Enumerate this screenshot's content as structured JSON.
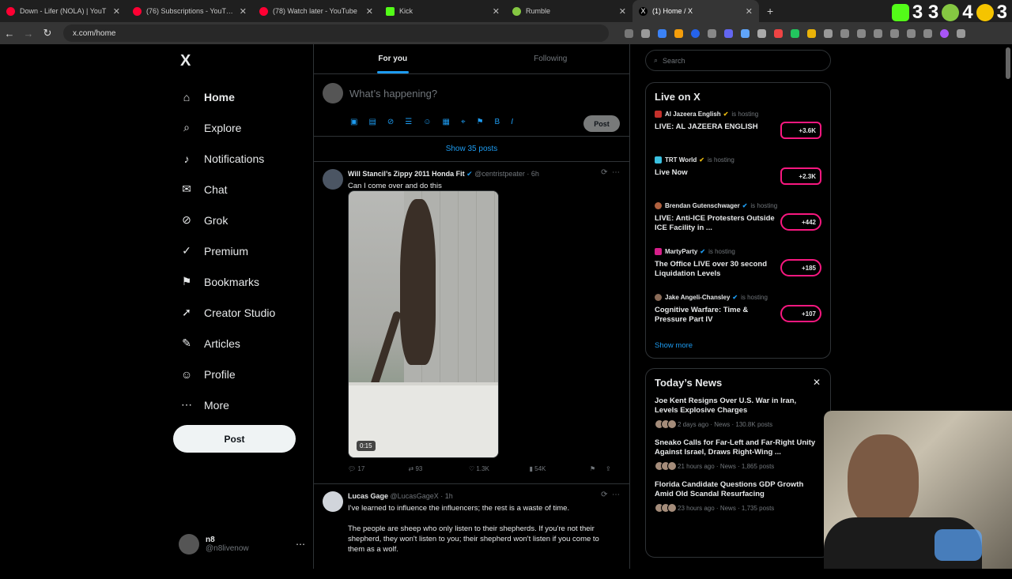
{
  "browser": {
    "tabs": [
      {
        "title": "Down - Lifer (NOLA) | YouT",
        "color": "#ff0033",
        "active": false
      },
      {
        "title": "(76) Subscriptions - YouTube",
        "color": "#ff0033",
        "active": false
      },
      {
        "title": "(78) Watch later - YouTube",
        "color": "#ff0033",
        "active": false
      },
      {
        "title": "Kick",
        "color": "#53fc18",
        "active": false
      },
      {
        "title": "Rumble",
        "color": "#85c742",
        "active": false
      },
      {
        "title": "(1) Home / X",
        "color": "#ffffff",
        "active": true
      }
    ],
    "url": "x.com/home",
    "tray": {
      "kick_count": "3 3",
      "rumble_count": "4",
      "other_count": "3"
    }
  },
  "sidebar": {
    "logo": "X",
    "items": [
      {
        "label": "Home",
        "icon": "home-icon",
        "glyph": "⌂"
      },
      {
        "label": "Explore",
        "icon": "search-icon",
        "glyph": "⌕"
      },
      {
        "label": "Notifications",
        "icon": "bell-icon",
        "glyph": "♪"
      },
      {
        "label": "Chat",
        "icon": "mail-icon",
        "glyph": "✉"
      },
      {
        "label": "Grok",
        "icon": "grok-icon",
        "glyph": "⊘"
      },
      {
        "label": "Premium",
        "icon": "verified-icon",
        "glyph": "✓"
      },
      {
        "label": "Bookmarks",
        "icon": "bookmark-icon",
        "glyph": "⚑"
      },
      {
        "label": "Creator Studio",
        "icon": "rocket-icon",
        "glyph": "➚"
      },
      {
        "label": "Articles",
        "icon": "article-icon",
        "glyph": "✎"
      },
      {
        "label": "Profile",
        "icon": "person-icon",
        "glyph": "☺"
      },
      {
        "label": "More",
        "icon": "more-icon",
        "glyph": "⋯"
      }
    ],
    "post_label": "Post",
    "account": {
      "name": "n8",
      "handle": "@n8livenow"
    }
  },
  "feed": {
    "tabs": [
      "For you",
      "Following"
    ],
    "compose_placeholder": "What’s happening?",
    "compose_post": "Post",
    "show_posts": "Show 35 posts",
    "tweets": [
      {
        "name": "Will Stancil’s Zippy 2011 Honda Fit",
        "handle": "@centristpeater",
        "time": "· 6h",
        "text": "Can I come over and do this",
        "duration": "0:15",
        "replies": "17",
        "reposts": "93",
        "likes": "1.3K",
        "views": "54K"
      },
      {
        "name": "Lucas Gage",
        "handle": "@LucasGageX",
        "time": "· 1h",
        "text": "I've learned to influence the influencers; the rest is a waste of time.",
        "text2": "The people are sheep who only listen to their shepherds. If you're not their shepherd, they won't listen to you; their shepherd won't listen if you come to them as a wolf."
      }
    ]
  },
  "right": {
    "search_placeholder": "Search",
    "live": {
      "title": "Live on X",
      "items": [
        {
          "host": "Al Jazeera English",
          "status": "is hosting",
          "title": "LIVE: AL JAZEERA ENGLISH",
          "count": "+3.6K",
          "color": "#c4302b"
        },
        {
          "host": "TRT World",
          "status": "is hosting",
          "title": "Live Now",
          "count": "+2.3K",
          "color": "#3ac1e0"
        },
        {
          "host": "Brendan Gutenschwager",
          "status": "is hosting",
          "title": "LIVE: Anti-ICE Protesters Outside ICE Facility in ...",
          "count": "+442",
          "color": "#b0613f"
        },
        {
          "host": "MartyParty",
          "status": "is hosting",
          "title": "The Office LIVE over 30 second Liquidation Levels",
          "count": "+185",
          "color": "#d61f8a"
        },
        {
          "host": "Jake Angeli-Chansley",
          "status": "is hosting",
          "title": "Cognitive Warfare: Time & Pressure Part IV",
          "count": "+107",
          "color": "#8a6b58"
        }
      ],
      "show_more": "Show more"
    },
    "news": {
      "title": "Today’s News",
      "items": [
        {
          "title": "Joe Kent Resigns Over U.S. War in Iran, Levels Explosive Charges",
          "meta": "2 days ago · News · 130.8K posts"
        },
        {
          "title": "Sneako Calls for Far-Left and Far-Right Unity Against Israel, Draws Right-Wing ...",
          "meta": "21 hours ago · News · 1,865 posts"
        },
        {
          "title": "Florida Candidate Questions GDP Growth Amid Old Scandal Resurfacing",
          "meta": "23 hours ago · News · 1,735 posts"
        }
      ]
    }
  },
  "colors": {
    "accent": "#1d9bf0",
    "live_badge": "#f91880",
    "background": "#000000"
  }
}
